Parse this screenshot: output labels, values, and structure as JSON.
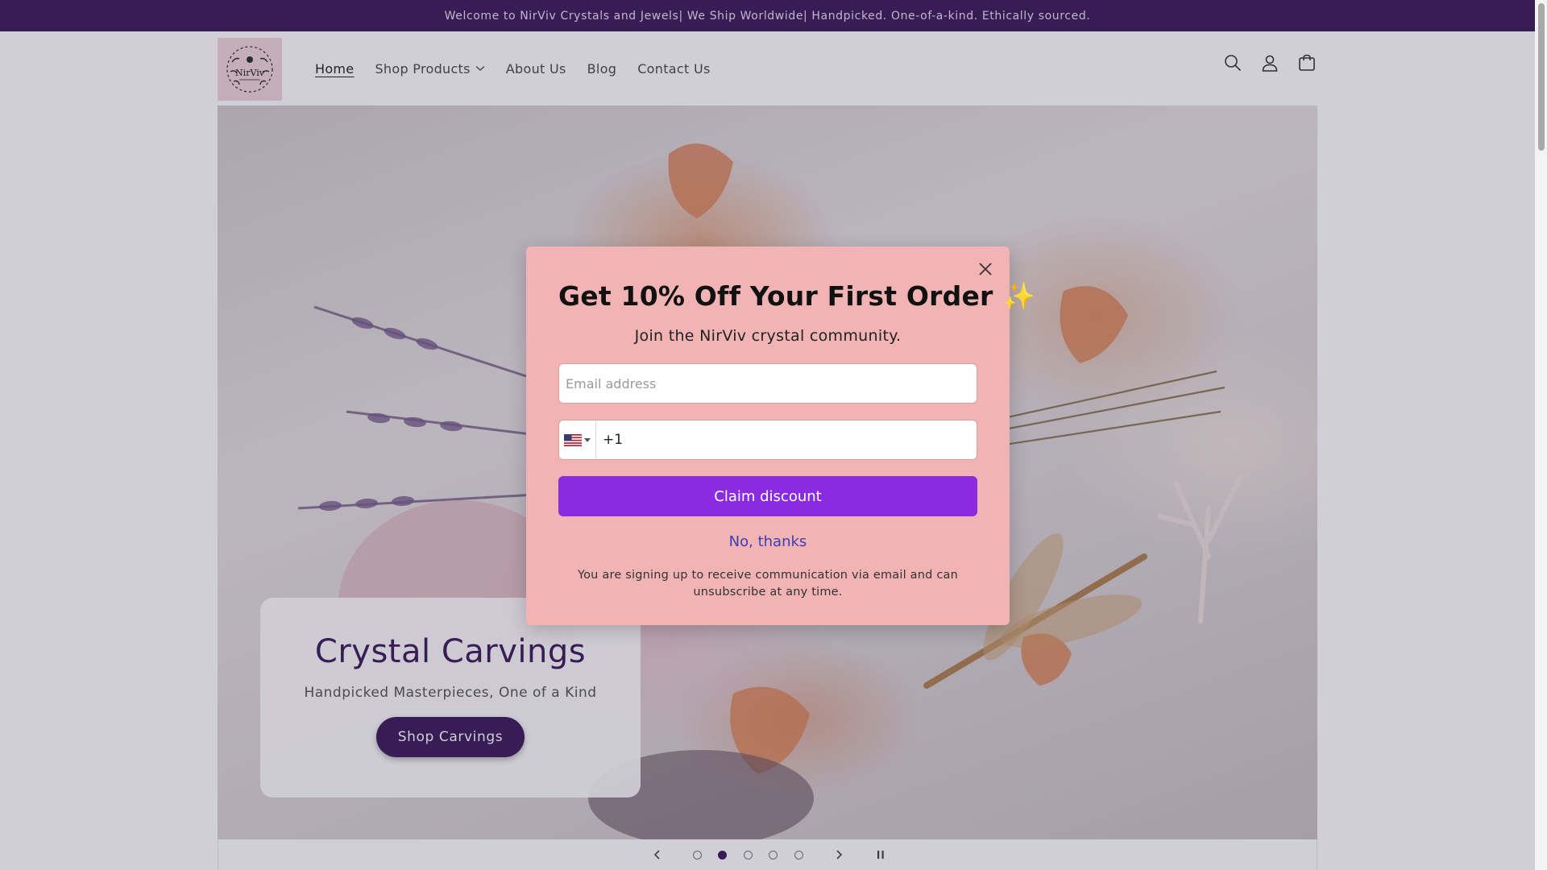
{
  "announcement": {
    "text": "Welcome to NirViv Crystals and Jewels| We Ship Worldwide| Handpicked. One-of-a-kind. Ethically sourced."
  },
  "header": {
    "logo_text": "NirViv",
    "nav": [
      {
        "label": "Home"
      },
      {
        "label": "Shop Products"
      },
      {
        "label": "About Us"
      },
      {
        "label": "Blog"
      },
      {
        "label": "Contact Us"
      }
    ],
    "icons": [
      "search-icon",
      "account-icon",
      "cart-icon"
    ]
  },
  "hero": {
    "title": "Crystal Carvings",
    "subtitle": "Handpicked Masterpieces, One of a Kind",
    "button_label": "Shop Carvings"
  },
  "slideshow": {
    "slide_count": 5,
    "active_slide": 2
  },
  "popup": {
    "title": "Get 10% Off Your First Order ✨",
    "subtitle": "Join the NirViv crystal community.",
    "email_placeholder": "Email address",
    "phone_prefix": "+1",
    "claim_label": "Claim discount",
    "decline_label": "No, thanks",
    "disclaimer": "You are signing up to receive communication via email and can unsubscribe at any time."
  },
  "colors": {
    "brand": "#3b1b5a",
    "popup_bg": "#f1b3b3",
    "claim_button": "#8a2be2",
    "link": "#3d3db8"
  }
}
